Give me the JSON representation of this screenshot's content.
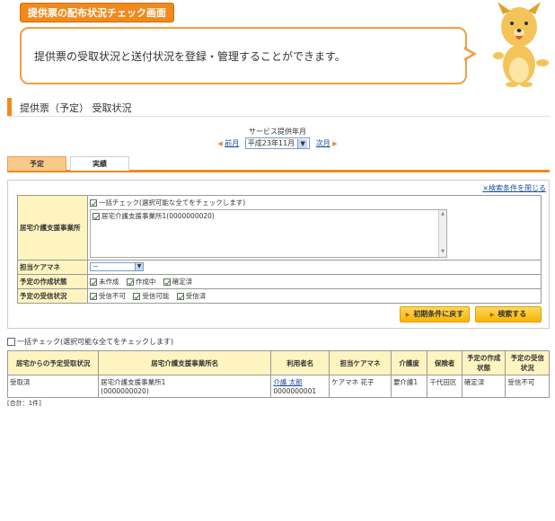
{
  "banner": {
    "tag": "提供票の配布状況チェック画面",
    "message": "提供票の受取状況と送付状況を登録・管理することができます。"
  },
  "section": {
    "title": "提供票（予定）  受取状況"
  },
  "period": {
    "label": "サービス提供年月",
    "prev": "前月",
    "selected": "平成23年11月",
    "next": "次月"
  },
  "tabs": [
    {
      "label": "予定",
      "active": true
    },
    {
      "label": "実績",
      "active": false
    }
  ],
  "search": {
    "close_link": "×検索条件を閉じる",
    "office": {
      "label": "居宅介護支援事業所",
      "bulk_check": "一括チェック(選択可能な全てをチェックします)",
      "items": [
        "居宅介護支援事業所1(0000000020)"
      ]
    },
    "care_manager": {
      "label": "担当ケアマネ",
      "value": "－"
    },
    "creation_status": {
      "label": "予定の作成状態",
      "options": [
        "未作成",
        "作成中",
        "確定済"
      ]
    },
    "receipt_status": {
      "label": "予定の受信状況",
      "options": [
        "受信不可",
        "受信可能",
        "受信済"
      ]
    },
    "reset_button": "初期条件に戻す",
    "search_button": "検索する"
  },
  "bulk_check": "一括チェック(選択可能な全てをチェックします)",
  "results": {
    "headers": [
      "居宅からの予定受取状況",
      "居宅介護支援事業所名",
      "利用者名",
      "担当ケアマネ",
      "介護度",
      "保険者",
      "予定の作成状態",
      "予定の受信状況"
    ],
    "rows": [
      {
        "status": "受取済",
        "office": "居宅介護支援事業所1",
        "office_id": "(0000000020)",
        "user_name": "介護 太郎",
        "user_id": "0000000001",
        "care_manager": "ケアマネ 花子",
        "care_level": "要介護1",
        "insurer": "千代田区",
        "creation": "確定済",
        "receipt": "受信不可"
      }
    ],
    "total": "[合計：1件]"
  },
  "colors": {
    "accent": "#f08a1c",
    "label_bg": "#fdf4c0",
    "link": "#1a4fa0"
  }
}
